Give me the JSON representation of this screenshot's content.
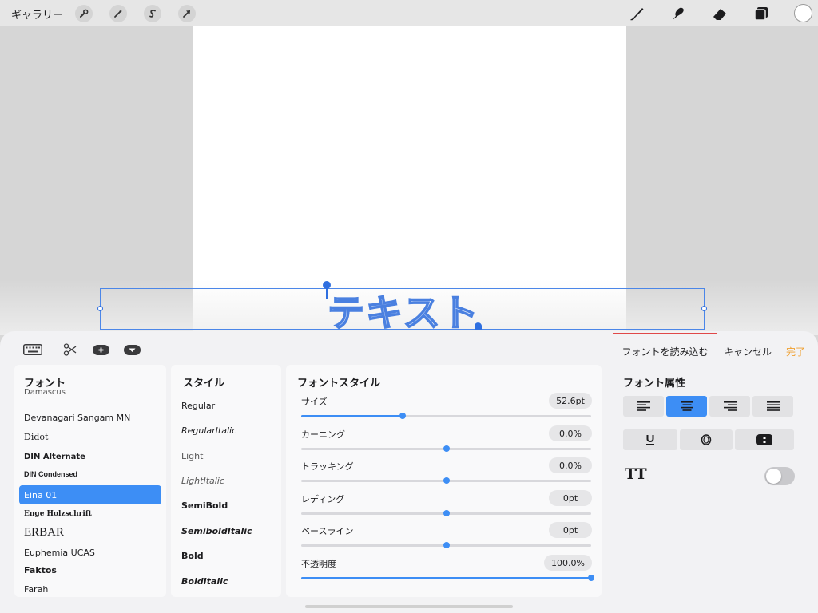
{
  "topbar": {
    "gallery_label": "ギャラリー",
    "left_tools": [
      "wrench-icon",
      "magic-wand-icon",
      "selection-s-icon",
      "transform-arrow-icon"
    ],
    "right_tools": [
      "brush-icon",
      "smudge-icon",
      "eraser-icon",
      "layers-icon"
    ],
    "color_well": "#ffffff"
  },
  "canvas": {
    "text": "テキスト"
  },
  "panel": {
    "load_font_label": "フォントを読み込む",
    "cancel_label": "キャンセル",
    "done_label": "完了",
    "done_color": "#f0a030",
    "fonts": {
      "title": "フォント",
      "items": [
        "Damascus",
        "Devanagari Sangam MN",
        "Didot",
        "DIN Alternate",
        "DIN Condensed",
        "Eina 01",
        "Enge Holzschrift",
        "ERBAR",
        "Euphemia UCAS",
        "Faktos",
        "Farah"
      ],
      "selected": "Eina 01"
    },
    "styles": {
      "title": "スタイル",
      "items": [
        "Regular",
        "RegularItalic",
        "Light",
        "LightItalic",
        "SemiBold",
        "SemiboldItalic",
        "Bold",
        "BoldItalic"
      ]
    },
    "font_style": {
      "title": "フォントスタイル",
      "sliders": [
        {
          "label": "サイズ",
          "value": "52.6pt",
          "level": 0.35
        },
        {
          "label": "カーニング",
          "value": "0.0%",
          "level": 0.5
        },
        {
          "label": "トラッキング",
          "value": "0.0%",
          "level": 0.5
        },
        {
          "label": "レディング",
          "value": "0pt",
          "level": 0.5
        },
        {
          "label": "ベースライン",
          "value": "0pt",
          "level": 0.5
        },
        {
          "label": "不透明度",
          "value": "100.0%",
          "level": 1.0
        }
      ]
    },
    "attributes": {
      "title": "フォント属性",
      "tt_label": "TT",
      "toggle_on": false,
      "accent": "#3d8ef5"
    }
  }
}
